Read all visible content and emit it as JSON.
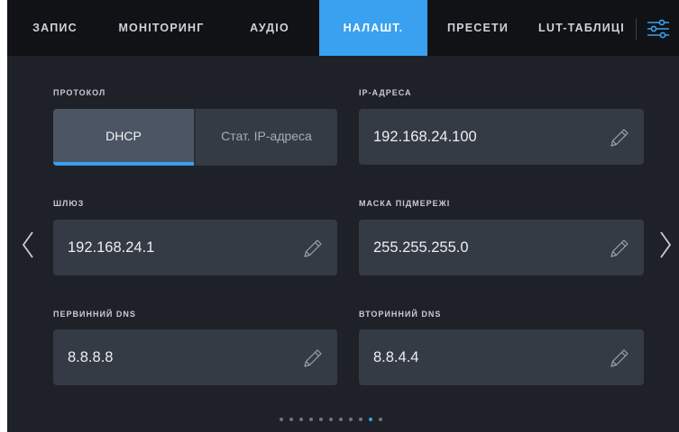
{
  "tabs": [
    {
      "label": "ЗАПИС",
      "active": false
    },
    {
      "label": "МОНІТОРИНГ",
      "active": false
    },
    {
      "label": "АУДІО",
      "active": false
    },
    {
      "label": "НАЛАШТ.",
      "active": true
    },
    {
      "label": "ПРЕСЕТИ",
      "active": false
    },
    {
      "label": "LUT-ТАБЛИЦІ",
      "active": false
    }
  ],
  "protocol": {
    "label": "ПРОТОКОЛ",
    "options": [
      "DHCP",
      "Стат. IP-адреса"
    ],
    "selected": "DHCP"
  },
  "ip_address": {
    "label": "IP-АДРЕСА",
    "value": "192.168.24.100"
  },
  "gateway": {
    "label": "ШЛЮЗ",
    "value": "192.168.24.1"
  },
  "subnet_mask": {
    "label": "МАСКА ПІДМЕРЕЖІ",
    "value": "255.255.255.0"
  },
  "primary_dns": {
    "label": "ПЕРВИННИЙ DNS",
    "value": "8.8.8.8"
  },
  "secondary_dns": {
    "label": "ВТОРИННИЙ DNS",
    "value": "8.8.4.4"
  },
  "pagination": {
    "total": 11,
    "current": 10
  },
  "icons": {
    "settings": "sliders-icon",
    "edit": "pencil-icon",
    "prev": "chevron-left-icon",
    "next": "chevron-right-icon"
  },
  "colors": {
    "accent": "#3aa0f0",
    "background": "#1e2228",
    "field": "#353b44",
    "tabbar": "#101215"
  }
}
